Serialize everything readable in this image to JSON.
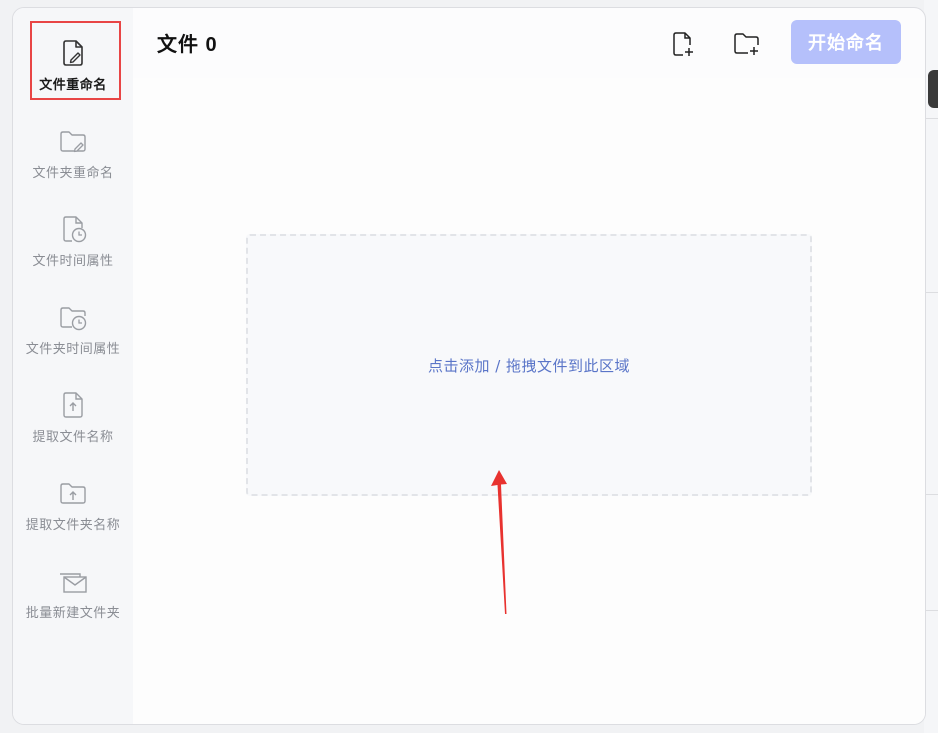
{
  "header": {
    "title": "文件 0",
    "start_button": "开始命名",
    "start_button_color": "#b5c0fb"
  },
  "toolbar": {
    "add_file_icon": "file-plus-icon",
    "add_folder_icon": "folder-plus-icon"
  },
  "sidebar": {
    "items": [
      {
        "label": "文件重命名",
        "icon": "file-edit-icon",
        "active": true
      },
      {
        "label": "文件夹重命名",
        "icon": "folder-edit-icon",
        "active": false
      },
      {
        "label": "文件时间属性",
        "icon": "file-clock-icon",
        "active": false
      },
      {
        "label": "文件夹时间属性",
        "icon": "folder-clock-icon",
        "active": false
      },
      {
        "label": "提取文件名称",
        "icon": "file-upload-icon",
        "active": false
      },
      {
        "label": "提取文件夹名称",
        "icon": "folder-upload-icon",
        "active": false
      },
      {
        "label": "批量新建文件夹",
        "icon": "folders-mail-icon",
        "active": false
      }
    ]
  },
  "drop_zone": {
    "text": "点击添加 / 拖拽文件到此区域"
  },
  "colors": {
    "accent": "#b5c0fb",
    "drop_text": "#5a75c8",
    "highlight": "#e84545"
  }
}
